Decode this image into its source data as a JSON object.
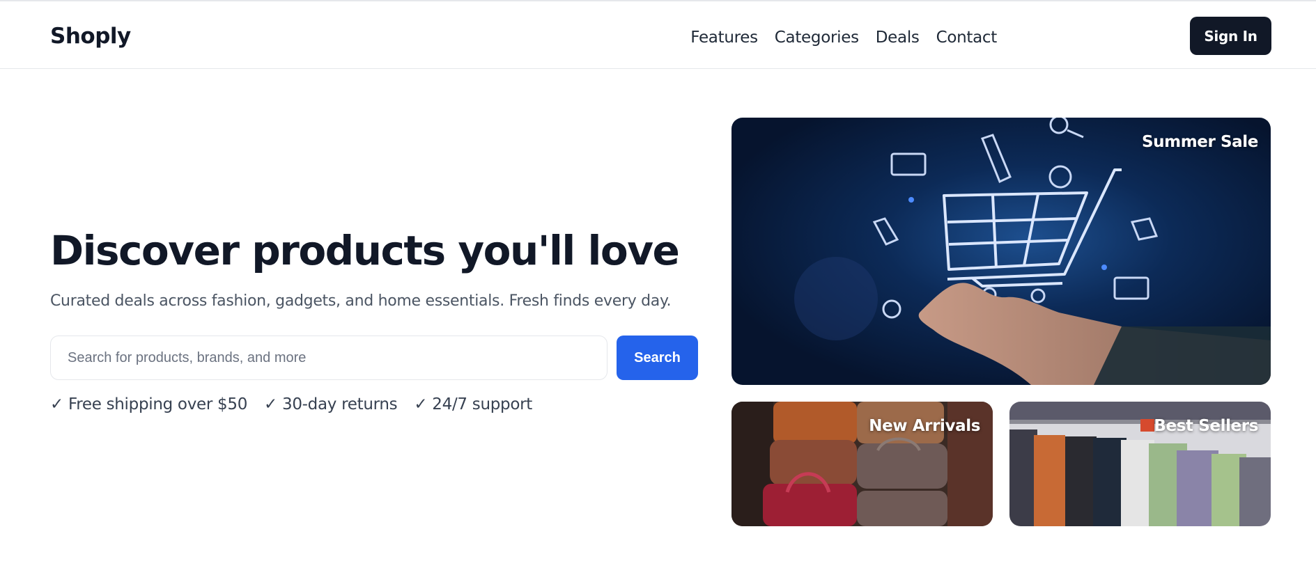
{
  "header": {
    "logo": "Shoply",
    "nav": [
      "Features",
      "Categories",
      "Deals",
      "Contact"
    ],
    "signin_label": "Sign In"
  },
  "hero": {
    "title": "Discover products you'll love",
    "subtitle": "Curated deals across fashion, gadgets, and home essentials. Fresh finds every day.",
    "search": {
      "placeholder": "Search for products, brands, and more",
      "button_label": "Search"
    },
    "perks": [
      "✓ Free shipping over $50",
      "✓ 30-day returns",
      "✓ 24/7 support"
    ]
  },
  "cards": {
    "sale": {
      "label": "Summer Sale",
      "icon": "shopping-cart-hand-image"
    },
    "new_arrivals": {
      "label": "New Arrivals",
      "icon": "leather-bags-image"
    },
    "best_sellers": {
      "label": "Best Sellers",
      "icon": "clothing-rack-image"
    }
  },
  "colors": {
    "primary_dark": "#111827",
    "accent_blue": "#2563eb",
    "muted_text": "#4b5563"
  }
}
